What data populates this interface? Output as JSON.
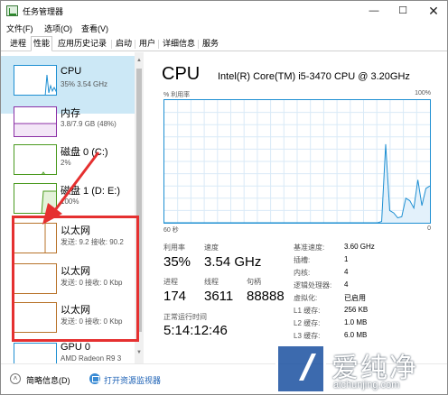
{
  "window": {
    "title": "任务管理器"
  },
  "menu": {
    "items": [
      "文件(F)",
      "选项(O)",
      "查看(V)"
    ]
  },
  "tabs": [
    "进程",
    "性能",
    "应用历史记录",
    "启动",
    "用户",
    "详细信息",
    "服务"
  ],
  "active_tab": "性能",
  "sidebar": {
    "items": [
      {
        "title": "CPU",
        "sub": "35% 3.54 GHz",
        "color": "#1e8fd2",
        "selected": true
      },
      {
        "title": "内存",
        "sub": "3.8/7.9 GB (48%)",
        "color": "#8b2fa6"
      },
      {
        "title": "磁盘 0 (C:)",
        "sub": "2%",
        "color": "#4a9a1e"
      },
      {
        "title": "磁盘 1 (D: E:)",
        "sub": "100%",
        "color": "#4a9a1e"
      },
      {
        "title": "以太网",
        "sub": "发送: 9.2  接收: 90.2",
        "color": "#b8732a"
      },
      {
        "title": "以太网",
        "sub": "发送: 0  接收: 0 Kbp",
        "color": "#b8732a"
      },
      {
        "title": "以太网",
        "sub": "发送: 0  接收: 0 Kbp",
        "color": "#b8732a"
      },
      {
        "title": "GPU 0",
        "sub": "AMD Radeon R9 3",
        "color": "#1e8fd2"
      }
    ]
  },
  "detail": {
    "title": "CPU",
    "model": "Intel(R) Core(TM) i5-3470 CPU @ 3.20GHz",
    "util_label": "% 利用率",
    "util_max": "100%",
    "axis_left": "60 秒",
    "axis_right": "0",
    "stats": {
      "util_label": "利用率",
      "util_value": "35%",
      "speed_label": "速度",
      "speed_value": "3.54 GHz",
      "proc_label": "进程",
      "proc_value": "174",
      "thread_label": "线程",
      "thread_value": "3611",
      "handle_label": "句柄",
      "handle_value": "88888",
      "uptime_label": "正常运行时间",
      "uptime_value": "5:14:12:46"
    },
    "kv": [
      {
        "k": "基准速度:",
        "v": "3.60 GHz"
      },
      {
        "k": "插槽:",
        "v": "1"
      },
      {
        "k": "内核:",
        "v": "4"
      },
      {
        "k": "逻辑处理器:",
        "v": "4"
      },
      {
        "k": "虚拟化:",
        "v": "已启用"
      },
      {
        "k": "L1 缓存:",
        "v": "256 KB"
      },
      {
        "k": "L2 缓存:",
        "v": "1.0 MB"
      },
      {
        "k": "L3 缓存:",
        "v": "6.0 MB"
      }
    ]
  },
  "cpu_history": [
    0,
    0,
    0,
    0,
    0,
    0,
    0,
    0,
    0,
    0,
    0,
    0,
    0,
    0,
    0,
    0,
    0,
    0,
    0,
    0,
    0,
    0,
    0,
    0,
    0,
    0,
    0,
    0,
    0,
    0,
    0,
    0,
    0,
    0,
    0,
    0,
    0,
    0,
    0,
    0,
    0,
    0,
    0,
    0,
    0,
    0,
    0,
    0,
    0,
    0,
    0,
    0,
    0,
    0,
    1,
    64,
    10,
    8,
    4,
    5,
    20,
    18,
    12,
    35,
    14,
    28,
    30
  ],
  "footer": {
    "fold": "简略信息(D)",
    "monitor": "打开资源监视器"
  },
  "watermark": {
    "text": "爱纯净",
    "url": "aichunjing.com"
  }
}
